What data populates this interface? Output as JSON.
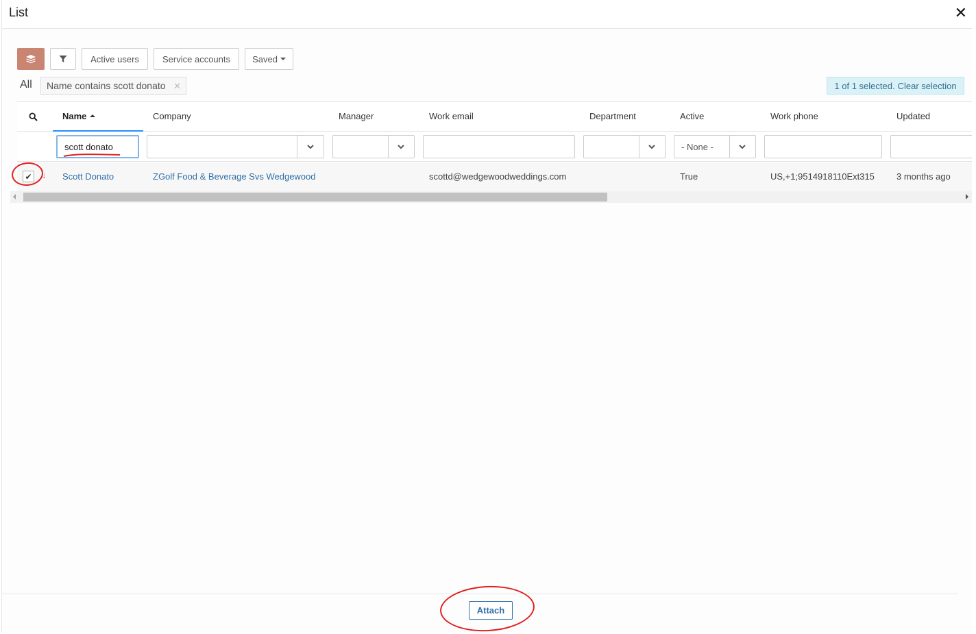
{
  "window": {
    "title": "List"
  },
  "toolbar": {
    "layers_icon": "layers-icon",
    "filter_icon": "funnel-icon",
    "active_users": "Active users",
    "service_accounts": "Service accounts",
    "saved": "Saved"
  },
  "breadcrumb": {
    "all": "All",
    "filter_condition": "Name contains scott donato"
  },
  "selection": {
    "status": "1 of 1 selected.",
    "clear": "Clear selection"
  },
  "columns": [
    "Name",
    "Company",
    "Manager",
    "Work email",
    "Department",
    "Active",
    "Work phone",
    "Updated"
  ],
  "filters": {
    "name": "scott donato",
    "active_select": "- None -"
  },
  "rows": [
    {
      "selected": true,
      "name": "Scott Donato",
      "company": "ZGolf Food & Beverage Svs Wedgewood",
      "manager": "",
      "work_email": "scottd@wedgewoodweddings.com",
      "department": "",
      "active": "True",
      "work_phone": "US,+1;9514918110Ext315",
      "updated": "3 months ago"
    }
  ],
  "footer": {
    "attach": "Attach"
  },
  "colors": {
    "accent": "#2f70a7",
    "layers_button": "#c98472",
    "annotation": "#e0201f",
    "badge_bg": "#d9f1f7"
  }
}
